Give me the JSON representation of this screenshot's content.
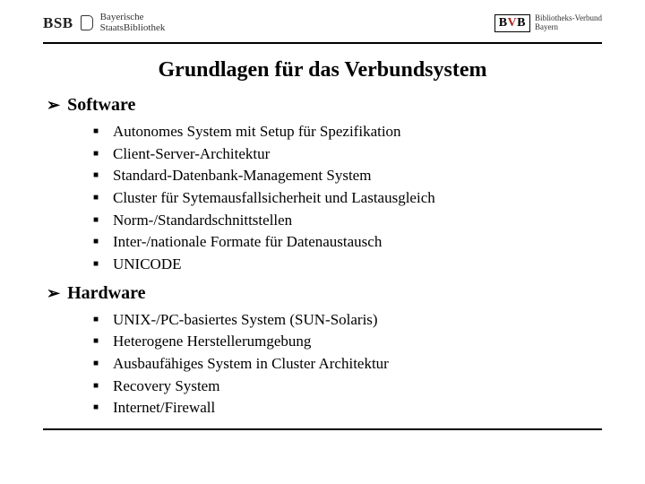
{
  "header": {
    "left_logo": {
      "abbr": "BSB",
      "line1": "Bayerische",
      "line2": "StaatsBibliothek"
    },
    "right_logo": {
      "abbr_plain": "B",
      "abbr_color": "V",
      "abbr_plain2": "B",
      "line1": "Bibliotheks-Verbund",
      "line2": "Bayern"
    }
  },
  "title": "Grundlagen für das Verbundsystem",
  "sections": [
    {
      "heading": "Software",
      "items": [
        "Autonomes System mit Setup für Spezifikation",
        "Client-Server-Architektur",
        "Standard-Datenbank-Management System",
        "Cluster für Sytemausfallsicherheit und Lastausgleich",
        "Norm-/Standardschnittstellen",
        "Inter-/nationale Formate für Datenaustausch",
        "UNICODE"
      ]
    },
    {
      "heading": "Hardware",
      "items": [
        "UNIX-/PC-basiertes System (SUN-Solaris)",
        "Heterogene Herstellerumgebung",
        "Ausbaufähiges System in Cluster Architektur",
        "Recovery System",
        "Internet/Firewall"
      ]
    }
  ]
}
